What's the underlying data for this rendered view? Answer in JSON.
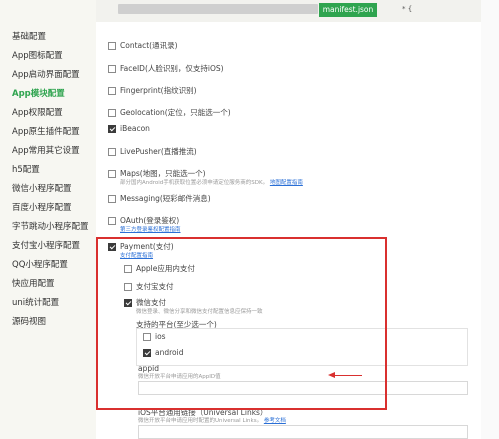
{
  "sidebar": {
    "items": [
      {
        "label": "基础配置"
      },
      {
        "label": "App图标配置"
      },
      {
        "label": "App启动界面配置"
      },
      {
        "label": "App模块配置"
      },
      {
        "label": "App权限配置"
      },
      {
        "label": "App原生插件配置"
      },
      {
        "label": "App常用其它设置"
      },
      {
        "label": "h5配置"
      },
      {
        "label": "微信小程序配置"
      },
      {
        "label": "百度小程序配置"
      },
      {
        "label": "字节跳动小程序配置"
      },
      {
        "label": "支付宝小程序配置"
      },
      {
        "label": "QQ小程序配置"
      },
      {
        "label": "快应用配置"
      },
      {
        "label": "uni统计配置"
      },
      {
        "label": "源码视图"
      }
    ],
    "active_index": 3,
    "active_color": "#2fa44f"
  },
  "tabs": {
    "active_label": "manifest.json",
    "extra": "* {"
  },
  "modules": {
    "contact": {
      "label": "Contact(通讯录)",
      "checked": false
    },
    "faceid": {
      "label": "FaceID(人脸识别，仅支持iOS)",
      "checked": false
    },
    "fingerprint": {
      "label": "Fingerprint(指纹识别)",
      "checked": false
    },
    "geolocation": {
      "label": "Geolocation(定位，只能选一个)",
      "checked": false
    },
    "ibeacon": {
      "label": "iBeacon",
      "checked": true
    },
    "livepusher": {
      "label": "LivePusher(直播推流)",
      "checked": false
    },
    "maps": {
      "label": "Maps(地图，只能选一个)",
      "checked": false,
      "note": "部分国内Android手机获取位置必须申请定位服务商的SDK。",
      "link": "地图配置指南"
    },
    "messaging": {
      "label": "Messaging(短彩邮件消息)",
      "checked": false
    },
    "oauth": {
      "label": "OAuth(登录鉴权)",
      "checked": false,
      "link": "第三方登录鉴权配置指南"
    },
    "payment": {
      "label": "Payment(支付)",
      "checked": true,
      "link": "支付配置指南",
      "options": {
        "apple": {
          "label": "Apple应用内支付",
          "checked": false
        },
        "alipay": {
          "label": "支付宝支付",
          "checked": false
        },
        "wechat": {
          "label": "微信支付",
          "checked": true,
          "note": "微信登录、微信分享和微信支付配置信息应保持一致",
          "platforms_label": "支持的平台(至少选一个)",
          "ios": {
            "label": "ios",
            "checked": false
          },
          "android": {
            "label": "android",
            "checked": true
          },
          "appid_label": "appid",
          "appid_note": "微信开放平台申请应用的AppID值"
        }
      }
    },
    "universal_links": {
      "label": "iOS平台通用链接（Universal Links）",
      "note": "微信开放平台申请应用时配置的Universal Links。",
      "link": "参考文档"
    }
  },
  "colors": {
    "highlight": "#d9302f",
    "accent": "#2fa44f",
    "link": "#2a6fd6"
  }
}
